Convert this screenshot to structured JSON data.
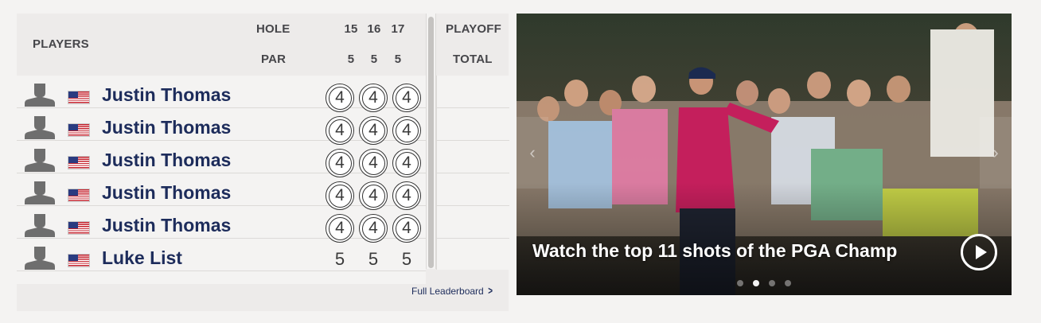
{
  "leaderboard": {
    "header": {
      "players_label": "PLAYERS",
      "hole_label": "HOLE",
      "par_label": "PAR",
      "holes": [
        "15",
        "16",
        "17"
      ],
      "pars": [
        "5",
        "5",
        "5"
      ],
      "playoff_label": "PLAYOFF",
      "total_label": "TOTAL"
    },
    "players": [
      {
        "name": "Justin Thomas",
        "scores": [
          "4",
          "4",
          "4"
        ],
        "circled": true
      },
      {
        "name": "Justin Thomas",
        "scores": [
          "4",
          "4",
          "4"
        ],
        "circled": true
      },
      {
        "name": "Justin Thomas",
        "scores": [
          "4",
          "4",
          "4"
        ],
        "circled": true
      },
      {
        "name": "Justin Thomas",
        "scores": [
          "4",
          "4",
          "4"
        ],
        "circled": true
      },
      {
        "name": "Justin Thomas",
        "scores": [
          "4",
          "4",
          "4"
        ],
        "circled": true
      },
      {
        "name": "Luke List",
        "scores": [
          "5",
          "5",
          "5"
        ],
        "circled": false
      }
    ],
    "full_leaderboard_label": "Full Leaderboard",
    "icons": {
      "avatar": "player-silhouette-icon",
      "flag": "usa-flag-icon",
      "chevron": "chevron-right-icon"
    }
  },
  "video": {
    "caption": "Watch the top 11 shots of the PGA Champ",
    "carousel": {
      "count": 4,
      "active_index": 1
    },
    "icons": {
      "play": "play-icon",
      "prev": "chevron-left-icon",
      "next": "chevron-right-icon"
    }
  },
  "colors": {
    "player_name": "#1d2c5b",
    "header_text": "#46464a",
    "panel_bg": "#edebea"
  }
}
